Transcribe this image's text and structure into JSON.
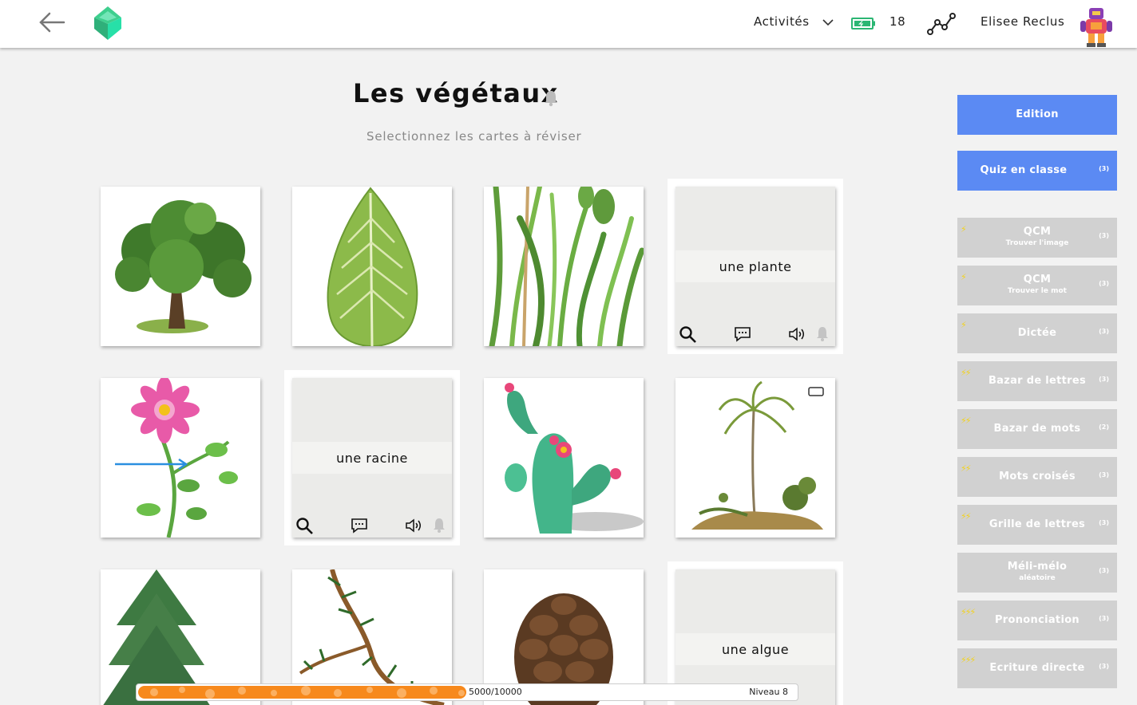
{
  "header": {
    "activities_label": "Activités",
    "count": "18",
    "user_name": "Elisee Reclus"
  },
  "page": {
    "title": "Les végétaux",
    "subtitle": "Selectionnez les cartes à réviser"
  },
  "cards": {
    "plante": "une plante",
    "racine": "une racine",
    "algue": "une algue"
  },
  "sidebar": {
    "edition": "Edition",
    "quiz": {
      "label": "Quiz en classe",
      "count": "(3)"
    },
    "activities": [
      {
        "label": "QCM",
        "sub": "Trouver l'image",
        "count": "(3)",
        "bolts": "⚡"
      },
      {
        "label": "QCM",
        "sub": "Trouver le mot",
        "count": "(3)",
        "bolts": "⚡"
      },
      {
        "label": "Dictée",
        "sub": "",
        "count": "(3)",
        "bolts": "⚡"
      },
      {
        "label": "Bazar de lettres",
        "sub": "",
        "count": "(3)",
        "bolts": "⚡⚡"
      },
      {
        "label": "Bazar de mots",
        "sub": "",
        "count": "(2)",
        "bolts": "⚡⚡"
      },
      {
        "label": "Mots croisés",
        "sub": "",
        "count": "(3)",
        "bolts": "⚡⚡"
      },
      {
        "label": "Grille de lettres",
        "sub": "",
        "count": "(3)",
        "bolts": "⚡⚡"
      },
      {
        "label": "Méli-mélo",
        "sub": "aléatoire",
        "count": "(3)",
        "bolts": ""
      },
      {
        "label": "Prononciation",
        "sub": "",
        "count": "(3)",
        "bolts": "⚡⚡⚡"
      },
      {
        "label": "Ecriture directe",
        "sub": "",
        "count": "(3)",
        "bolts": "⚡⚡⚡"
      }
    ]
  },
  "progress": {
    "text": "5000/10000",
    "level": "Niveau 8",
    "fraction": 0.5
  },
  "colors": {
    "accent_blue": "#5b8af3",
    "button_grey": "#d1d1d1",
    "progress_orange": "#f7891c",
    "bolt_yellow": "#f3d21b",
    "logo_green": "#3ecf8e"
  }
}
